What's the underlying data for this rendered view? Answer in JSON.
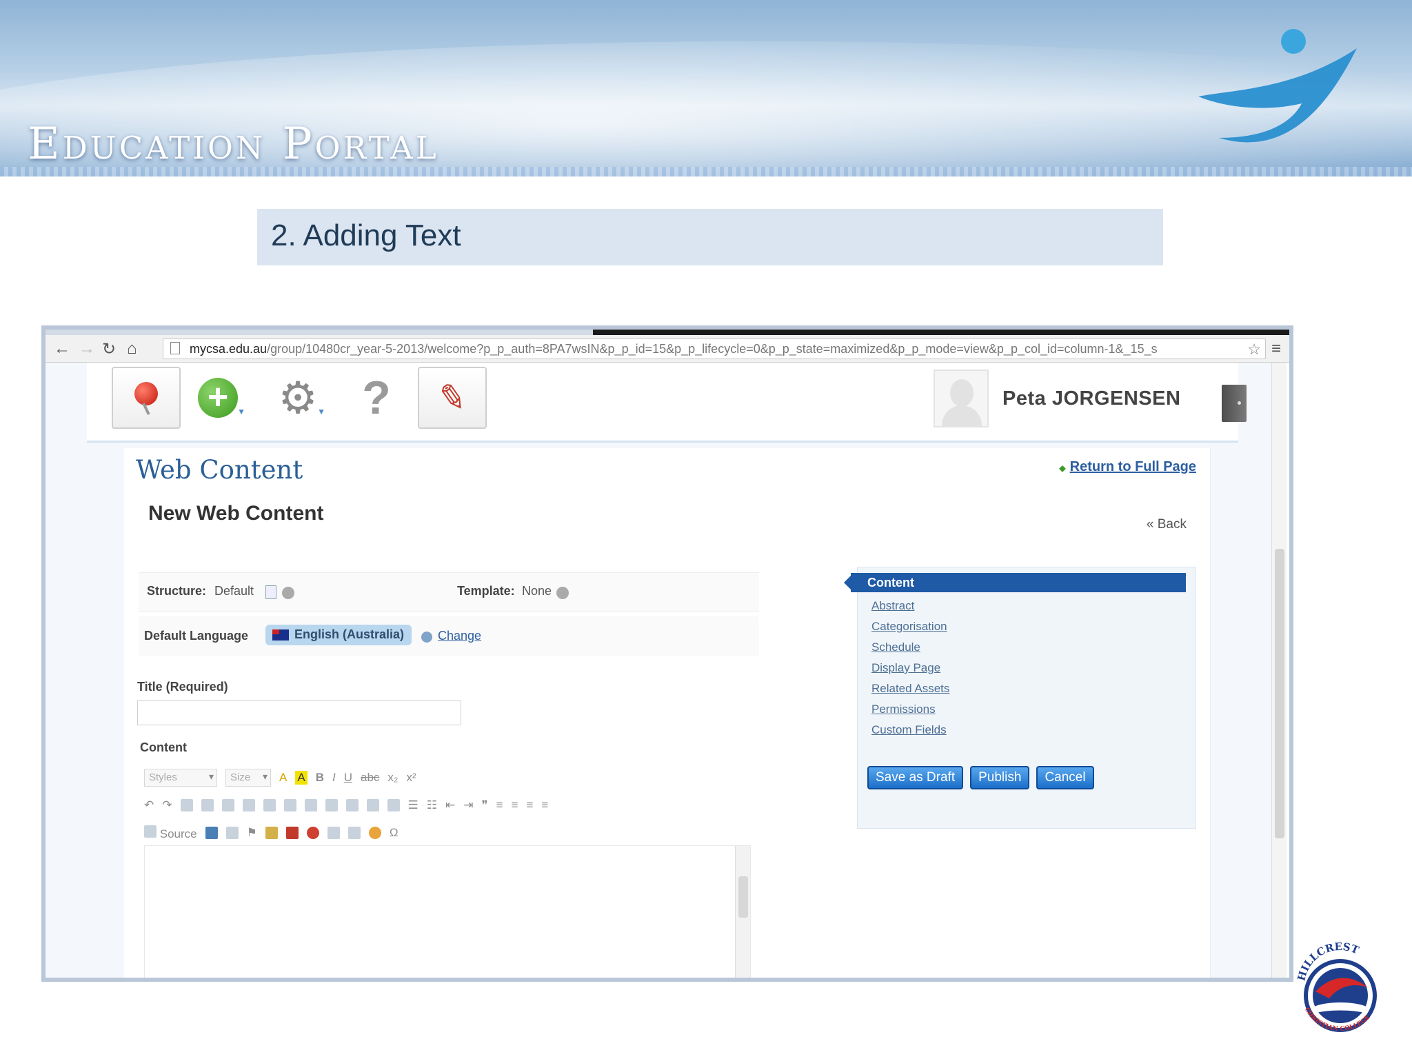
{
  "banner": {
    "title": "Education Portal"
  },
  "slide": {
    "title": "2. Adding Text"
  },
  "browser": {
    "url_host": "mycsa.edu.au",
    "url_path": "/group/10480cr_year-5-2013/welcome?p_p_auth=8PA7wsIN&p_p_id=15&p_p_lifecycle=0&p_p_state=maximized&p_p_mode=view&p_p_col_id=column-1&_15_s"
  },
  "dock": {
    "user_name": "Peta JORGENSEN"
  },
  "portlet": {
    "title": "Web Content",
    "return_link": "Return to Full Page",
    "subtitle": "New Web Content",
    "back_link": "« Back",
    "structure_label": "Structure:",
    "structure_value": "Default",
    "template_label": "Template:",
    "template_value": "None",
    "language_label": "Default Language",
    "language_value": "English (Australia)",
    "change_link": "Change",
    "title_label": "Title (Required)",
    "content_label": "Content",
    "toolbar": {
      "styles_placeholder": "Styles",
      "size_placeholder": "Size",
      "source_label": "Source"
    }
  },
  "side_panel": {
    "active": "Content",
    "items": [
      "Abstract",
      "Categorisation",
      "Schedule",
      "Display Page",
      "Related Assets",
      "Permissions",
      "Custom Fields"
    ],
    "buttons": {
      "save_draft": "Save as Draft",
      "publish": "Publish",
      "cancel": "Cancel"
    }
  },
  "logo": {
    "text_top": "HILLCREST",
    "text_bottom": "CHRISTIAN COLLEGE",
    "motto": "Excellence in Christ"
  },
  "colors": {
    "accent": "#1e5aa6",
    "title_bar": "#dbe5f1",
    "link": "#2b5ea0"
  }
}
